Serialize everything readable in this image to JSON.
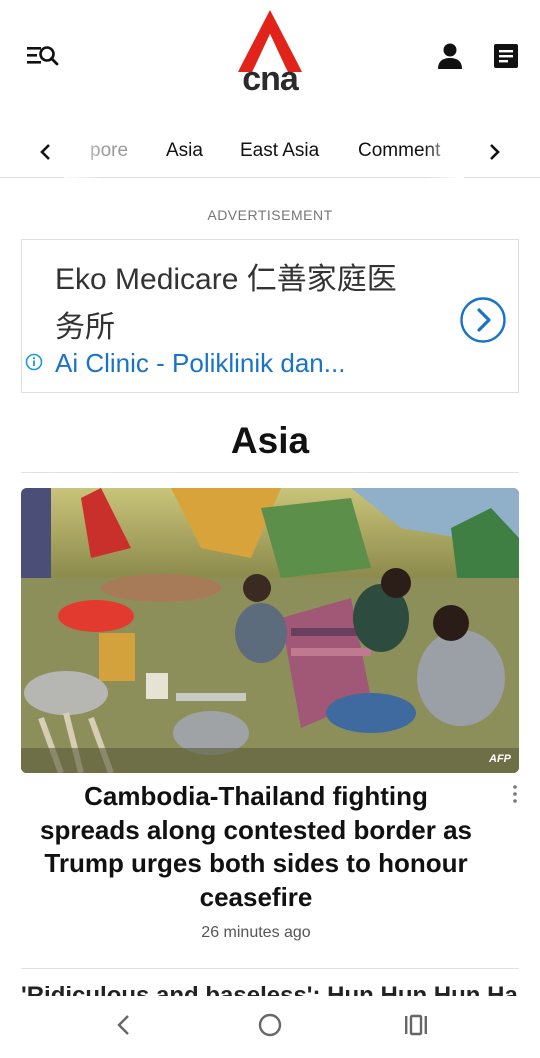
{
  "header": {
    "menu_icon": "menu-search-icon",
    "logo_text": "cna",
    "brand_red": "#e2231a",
    "user_icon": "user-icon",
    "doc_icon": "document-icon"
  },
  "nav": {
    "items": [
      "pore",
      "Asia",
      "East Asia",
      "Comment"
    ],
    "prev_icon": "chevron-left-icon",
    "next_icon": "chevron-right-icon"
  },
  "ad": {
    "label": "ADVERTISEMENT",
    "title": "Eko Medicare 仁善家庭医务所",
    "subtitle": "Ai Clinic - Poliklinik dan...",
    "link_color": "#1a73c8",
    "info_icon": "info-icon",
    "cta_icon": "chevron-right-circle-icon"
  },
  "section": {
    "title": "Asia"
  },
  "article": {
    "image_credit": "AFP",
    "headline": "Cambodia-Thailand fighting spreads along contested border as Trump urges both sides to honour ceasefire",
    "time": "26 minutes ago",
    "more_icon": "more-vertical-icon"
  },
  "next_article": {
    "headline_partial": "'Ridiculous and baseless': Hun Hun Hun Ha"
  },
  "system_nav": {
    "back_icon": "back-icon",
    "home_icon": "home-icon",
    "recents_icon": "recents-icon"
  }
}
